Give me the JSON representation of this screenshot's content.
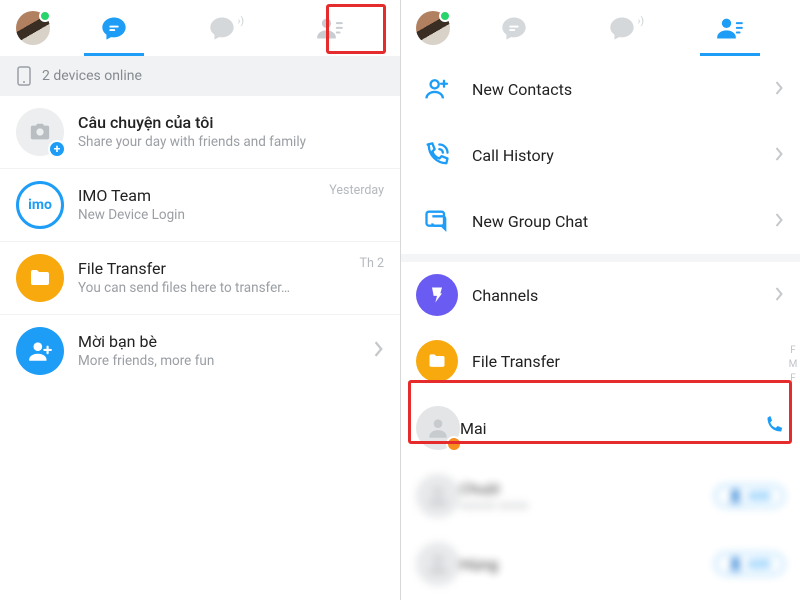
{
  "left": {
    "status": "2 devices online",
    "story": {
      "title": "Câu chuyện của tôi",
      "sub": "Share your day with friends and family"
    },
    "chats": [
      {
        "name": "IMO Team",
        "sub": "New Device Login",
        "meta": "Yesterday"
      },
      {
        "name": "File Transfer",
        "sub": "You can send files here to transfer…",
        "meta": "Th 2"
      }
    ],
    "invite": {
      "title": "Mời bạn bè",
      "sub": "More friends, more fun"
    }
  },
  "right": {
    "menu": {
      "new_contacts": "New Contacts",
      "call_history": "Call History",
      "new_group_chat": "New Group Chat",
      "channels": "Channels",
      "file_transfer": "File Transfer"
    },
    "contacts": [
      {
        "name": "Mai"
      }
    ],
    "blurred": [
      {
        "name": "Chuột",
        "sub": "xxxxxx xxxxx"
      },
      {
        "name": "Hùng",
        "sub": ""
      }
    ],
    "add_label": "ADD",
    "index_letters": [
      "F",
      "M",
      "F"
    ]
  },
  "icons": {
    "imo_text": "imo"
  }
}
